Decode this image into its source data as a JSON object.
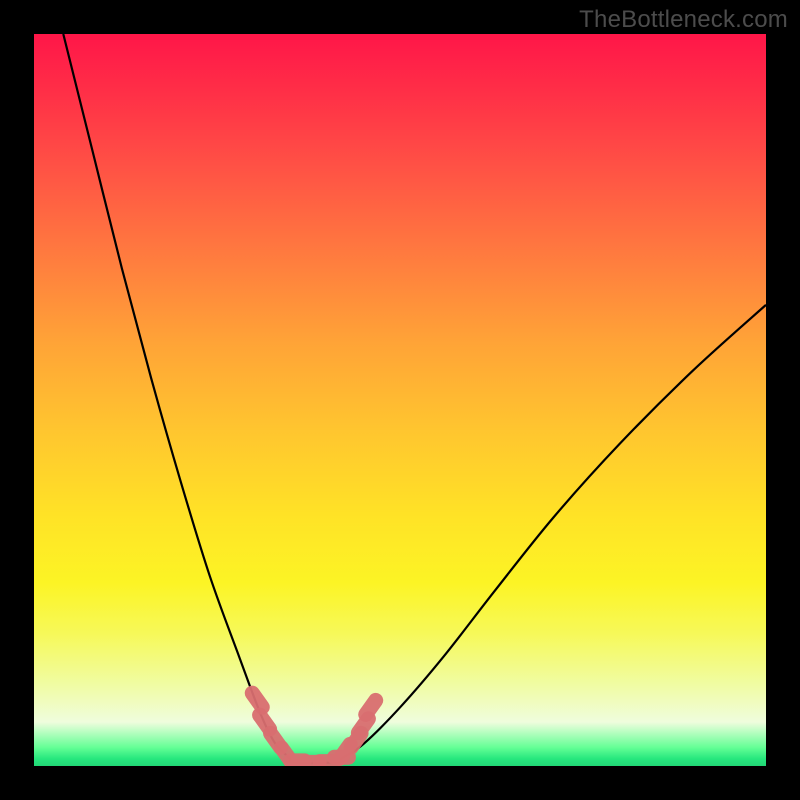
{
  "watermark": "TheBottleneck.com",
  "colors": {
    "frame": "#000000",
    "curve": "#000000",
    "markers_fill": "#d96e70",
    "markers_stroke": "#c85d5f",
    "gradient_top": "#ff1648",
    "gradient_bottom": "#22d676"
  },
  "chart_data": {
    "type": "line",
    "title": "",
    "xlabel": "",
    "ylabel": "",
    "xlim": [
      0,
      100
    ],
    "ylim": [
      0,
      100
    ],
    "grid": false,
    "legend_position": "none",
    "note": "Bottleneck-style curve: two branches descending to a flat minimum near x≈35–42 at y≈0; left branch steep from top-left, right branch rises to mid-right. Values below are estimated from pixel positions (no axis ticks present).",
    "series": [
      {
        "name": "left-branch",
        "x": [
          4,
          8,
          12,
          16,
          20,
          24,
          28,
          31,
          33,
          35
        ],
        "y": [
          100,
          84,
          68,
          53,
          39,
          26,
          15,
          7,
          3,
          1
        ]
      },
      {
        "name": "floor",
        "x": [
          35,
          42
        ],
        "y": [
          0.5,
          0.5
        ]
      },
      {
        "name": "right-branch",
        "x": [
          42,
          45,
          50,
          56,
          63,
          71,
          80,
          90,
          100
        ],
        "y": [
          1,
          3,
          8,
          15,
          24,
          34,
          44,
          54,
          63
        ]
      }
    ],
    "markers": {
      "note": "Salmon rounded markers clustered near the valley floor along both branches.",
      "points": [
        {
          "x": 30.5,
          "y": 9
        },
        {
          "x": 31.5,
          "y": 6
        },
        {
          "x": 33,
          "y": 3.5
        },
        {
          "x": 34.5,
          "y": 1.5
        },
        {
          "x": 36,
          "y": 0.7
        },
        {
          "x": 38,
          "y": 0.5
        },
        {
          "x": 40,
          "y": 0.6
        },
        {
          "x": 42,
          "y": 1.2
        },
        {
          "x": 44,
          "y": 3.5
        },
        {
          "x": 45,
          "y": 5.5
        },
        {
          "x": 46,
          "y": 8
        },
        {
          "x": 42.5,
          "y": 2
        }
      ]
    }
  }
}
